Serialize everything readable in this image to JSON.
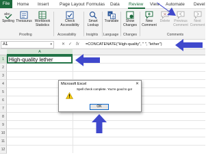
{
  "tabs": [
    {
      "label": "File"
    },
    {
      "label": "Home"
    },
    {
      "label": "Insert"
    },
    {
      "label": "Page Layout"
    },
    {
      "label": "Formulas"
    },
    {
      "label": "Data"
    },
    {
      "label": "Review"
    },
    {
      "label": "View"
    },
    {
      "label": "Automate"
    },
    {
      "label": "Devel"
    }
  ],
  "ribbon": {
    "spelling": "Spelling",
    "thesaurus": "Thesaurus",
    "workbook_statistics": "Workbook Statistics",
    "proofing_group": "Proofing",
    "check_accessibility": "Check Accessibility",
    "accessibility_group": "Accessibility",
    "smart_lookup": "Smart Lookup",
    "insights_group": "Insights",
    "translate": "Translate",
    "language_group": "Language",
    "show_changes": "Show Changes",
    "changes_group": "Changes",
    "new_comment": "New Comment",
    "delete": "Delete",
    "previous_comment": "Previous Comment",
    "next_comment": "Next Comment",
    "comments_group": "Comments"
  },
  "formula_bar": {
    "name_box": "A1",
    "cancel": "✕",
    "enter": "✓",
    "fx": "fx",
    "formula": "=CONCATENATE(\"High-quality\", \" \", \"lether\")"
  },
  "grid": {
    "column_a": "A",
    "rows": [
      "1",
      "2",
      "3",
      "4",
      "5",
      "6",
      "7",
      "8",
      "9",
      "10",
      "11",
      "12"
    ],
    "a1_value": "High-quality lether"
  },
  "dialog": {
    "title": "Microsoft Excel",
    "close": "✕",
    "message": "Spell check complete. You're good to go!",
    "ok_label": "OK"
  },
  "colors": {
    "excel_green": "#1d6b3d",
    "annotation_arrow": "#3f48cc"
  }
}
